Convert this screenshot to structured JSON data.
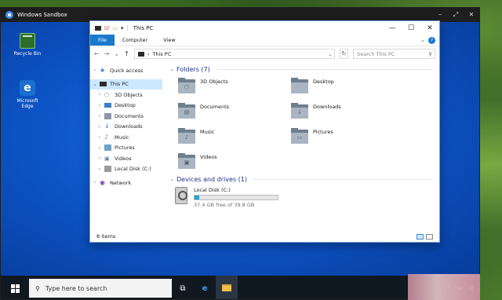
{
  "sandbox": {
    "title": "Windows Sandbox",
    "controls": [
      "⎯",
      "⤢",
      "✕"
    ]
  },
  "desktop_icons": [
    {
      "label": "Recycle Bin"
    },
    {
      "label": "Microsoft Edge"
    }
  ],
  "explorer": {
    "title": "This PC",
    "window_controls": [
      "—",
      "☐",
      "✕"
    ],
    "ribbon_tabs": [
      "File",
      "Computer",
      "View"
    ],
    "address": {
      "location": "This PC",
      "nav_back": "←",
      "nav_forward": "→",
      "nav_recent": "⌄",
      "nav_up": "↑"
    },
    "search_placeholder": "Search This PC",
    "nav_pane": {
      "quick_access": "Quick access",
      "this_pc": "This PC",
      "children": [
        "3D Objects",
        "Desktop",
        "Documents",
        "Downloads",
        "Music",
        "Pictures",
        "Videos",
        "Local Disk (C:)"
      ],
      "network": "Network"
    },
    "folders_group": "Folders (7)",
    "folders": [
      "3D Objects",
      "Desktop",
      "Documents",
      "Downloads",
      "Music",
      "Pictures",
      "Videos"
    ],
    "drives_group": "Devices and drives (1)",
    "drive": {
      "name": "Local Disk (C:)",
      "free_text": "37.4 GB free of 39.8 GB",
      "used_fraction": 0.06
    },
    "status_items": "8 items"
  },
  "taskbar": {
    "search_placeholder": "Type here to search"
  }
}
